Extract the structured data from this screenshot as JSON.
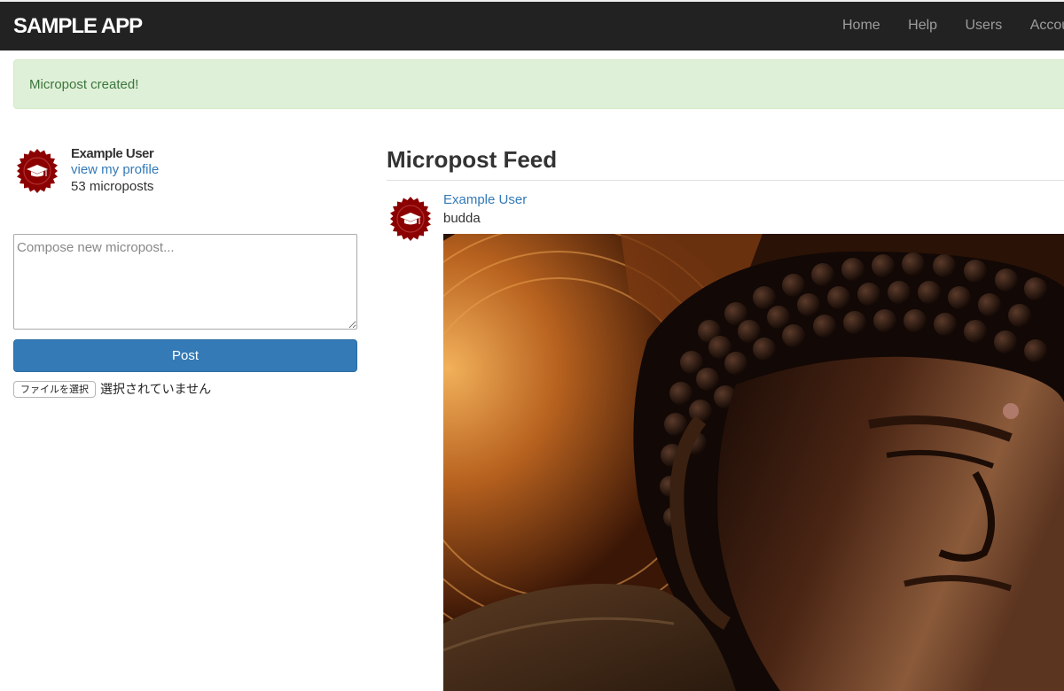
{
  "header": {
    "logo": "SAMPLE APP",
    "nav": [
      "Home",
      "Help",
      "Users",
      "Account"
    ]
  },
  "flash": {
    "message": "Micropost created!"
  },
  "sidebar": {
    "user_name": "Example User",
    "profile_link": "view my profile",
    "microposts_count": "53 microposts"
  },
  "composer": {
    "placeholder": "Compose new micropost...",
    "post_label": "Post",
    "file_button": "ファイルを選択",
    "file_status": "選択されていません"
  },
  "feed": {
    "title": "Micropost Feed",
    "items": [
      {
        "user": "Example User",
        "content": "budda",
        "image": "buddha-statue-photo"
      }
    ]
  },
  "colors": {
    "navbar": "#222222",
    "link": "#337ab7",
    "alert_bg": "#dff0d8",
    "alert_text": "#3c763d",
    "avatar": "#8b0000"
  }
}
